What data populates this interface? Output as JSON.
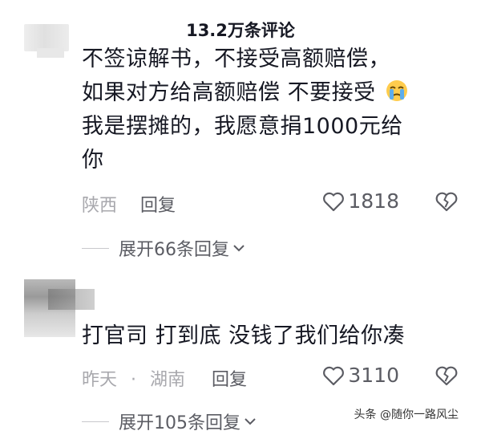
{
  "header": {
    "title": "13.2万条评论"
  },
  "comments": [
    {
      "lines": [
        "不签谅解书，不接受高额赔偿，",
        "如果对方给高额赔偿 不要接受",
        "我是摆摊的，我愿意捐1000元给",
        "你"
      ],
      "emoji": "crying-face-icon",
      "meta": {
        "time": "",
        "location": "陕西",
        "reply_label": "回复"
      },
      "likes": "1818",
      "expand_label": "展开66条回复"
    },
    {
      "lines": [
        "打官司 打到底 没钱了我们给你凑"
      ],
      "meta": {
        "time": "昨天",
        "separator": "·",
        "location": "湖南",
        "reply_label": "回复"
      },
      "likes": "3110",
      "expand_label": "展开105条回复"
    }
  ],
  "watermark": "头条 @随你一路风尘"
}
